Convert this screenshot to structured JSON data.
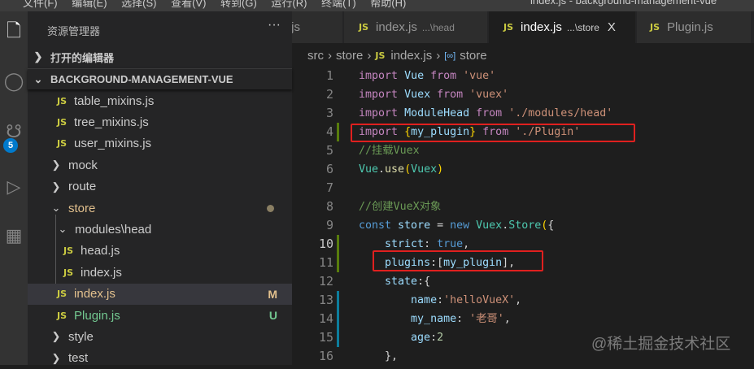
{
  "menubar": {
    "items": "文件(F) 编辑(E) 选择(S) 查看(V) 转到(G) 运行(R) 终端(T) 帮助(H)",
    "title": "index.js - background-management-vue"
  },
  "activity": {
    "scm_badge": "5"
  },
  "explorer": {
    "title": "资源管理器",
    "more": "···",
    "open_editors": "打开的编辑器",
    "project": "BACKGROUND-MANAGEMENT-VUE",
    "items": [
      {
        "label": "table_mixins.js",
        "type": "file"
      },
      {
        "label": "tree_mixins.js",
        "type": "file"
      },
      {
        "label": "user_mixins.js",
        "type": "file"
      },
      {
        "label": "mock",
        "type": "folder"
      },
      {
        "label": "route",
        "type": "folder"
      },
      {
        "label": "store",
        "type": "folder-open"
      },
      {
        "label": "modules\\head",
        "type": "folder-open"
      },
      {
        "label": "head.js",
        "type": "file"
      },
      {
        "label": "index.js",
        "type": "file"
      },
      {
        "label": "index.js",
        "type": "file",
        "status": "M"
      },
      {
        "label": "Plugin.js",
        "type": "file",
        "status": "U"
      },
      {
        "label": "style",
        "type": "folder"
      },
      {
        "label": "test",
        "type": "folder"
      }
    ]
  },
  "tabs": [
    {
      "label": "js"
    },
    {
      "label": "index.js",
      "desc": "...\\head"
    },
    {
      "label": "index.js",
      "desc": "...\\store",
      "close": "X"
    },
    {
      "label": "Plugin.js"
    }
  ],
  "breadcrumb": [
    "src",
    "store",
    "index.js",
    "store"
  ],
  "file_icon": "JS",
  "code": {
    "lines": [
      "1",
      "2",
      "3",
      "4",
      "5",
      "6",
      "7",
      "8",
      "9",
      "10",
      "11",
      "12",
      "13",
      "14",
      "15",
      "16"
    ]
  },
  "watermark": "@稀土掘金技术社区",
  "colors": {
    "accent": "#007acc",
    "highlight_box": "#e0201f",
    "added": "#587c0c",
    "modified": "#0c7d9d"
  }
}
